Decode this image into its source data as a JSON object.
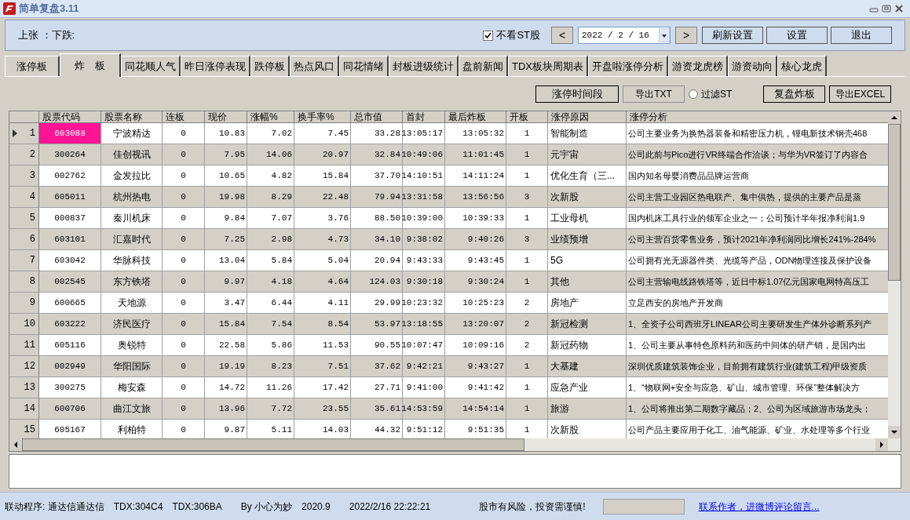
{
  "window": {
    "title": "简单复盘3.11"
  },
  "top_panel": {
    "rise_fall": "上张 ：下跌:",
    "hide_st": {
      "label": "不看ST股",
      "checked": true
    },
    "prev": "<",
    "date": "2022 / 2 / 16",
    "next": ">",
    "buttons": [
      "刷新设置",
      "设置",
      "退出"
    ]
  },
  "tabs": [
    {
      "label": "涨停板",
      "selected": false
    },
    {
      "label": "炸　板",
      "selected": true
    },
    {
      "label": "同花顺人气",
      "selected": false
    },
    {
      "label": "昨日涨停表现",
      "selected": false
    },
    {
      "label": "跌停板",
      "selected": false
    },
    {
      "label": "热点风口",
      "selected": false
    },
    {
      "label": "同花情绪",
      "selected": false
    },
    {
      "label": "封板进级统计",
      "selected": false
    },
    {
      "label": "盘前新闻",
      "selected": false
    },
    {
      "label": "TDX板块周期表",
      "selected": false
    },
    {
      "label": "开盘啦涨停分析",
      "selected": false
    },
    {
      "label": "游资龙虎榜",
      "selected": false
    },
    {
      "label": "游资动向",
      "selected": false
    },
    {
      "label": "核心龙虎",
      "selected": false
    }
  ],
  "toolbar": {
    "time_button": "涨停时间段",
    "export_txt": "导出TXT",
    "filter_st": {
      "label": "过滤ST",
      "checked": false
    },
    "replay_button": "复盘炸板",
    "export_excel": "导出EXCEL"
  },
  "table": {
    "columns": [
      "股票代码",
      "股票名称",
      "连板",
      "现价",
      "涨幅%",
      "换手率%",
      "总市值",
      "首封",
      "最后炸板",
      "开板",
      "涨停原因",
      "涨停分析"
    ],
    "rows": [
      {
        "index": "1",
        "selected": true,
        "cells": [
          "603088",
          "宁波精达",
          "0",
          "10.83",
          "7.02",
          "7.45",
          "33.28",
          "13:05:17",
          "13:05:32",
          "1",
          "智能制造",
          "公司主要业务为换热器装备和精密压力机，锂电新技术钢壳468"
        ]
      },
      {
        "index": "2",
        "selected": false,
        "cells": [
          "300264",
          "佳创视讯",
          "0",
          "7.95",
          "14.06",
          "20.97",
          "32.84",
          "10:49:06",
          "11:01:45",
          "1",
          "元宇宙",
          "公司此前与Pico进行VR终端合作洽谈；与华为VR签订了内容合"
        ]
      },
      {
        "index": "3",
        "selected": false,
        "cells": [
          "002762",
          "金发拉比",
          "0",
          "10.65",
          "4.82",
          "15.84",
          "37.70",
          "14:10:51",
          "14:11:24",
          "1",
          "优化生育（三...",
          "国内知名母婴消费品品牌运营商"
        ]
      },
      {
        "index": "4",
        "selected": false,
        "cells": [
          "605011",
          "杭州热电",
          "0",
          "19.98",
          "8.29",
          "22.48",
          "79.94",
          "13:31:58",
          "13:56:56",
          "3",
          "次新股",
          "公司主营工业园区热电联产、集中供热，提供的主要产品是蒸"
        ]
      },
      {
        "index": "5",
        "selected": false,
        "cells": [
          "000837",
          "秦川机床",
          "0",
          "9.84",
          "7.07",
          "3.76",
          "88.50",
          "10:39:00",
          "10:39:33",
          "1",
          "工业母机",
          "国内机床工具行业的领军企业之一；公司预计半年报净利润1.9"
        ]
      },
      {
        "index": "6",
        "selected": false,
        "cells": [
          "603101",
          "汇嘉时代",
          "0",
          "7.25",
          "2.98",
          "4.73",
          "34.10",
          "9:38:02",
          "9:40:26",
          "3",
          "业绩预增",
          "公司主营百货零售业务，预计2021年净利润同比增长241%-284%"
        ]
      },
      {
        "index": "7",
        "selected": false,
        "cells": [
          "603042",
          "华脉科技",
          "0",
          "13.04",
          "5.84",
          "5.04",
          "20.94",
          "9:43:33",
          "9:43:45",
          "1",
          "5G",
          "公司拥有光无源器件类、光缆等产品，ODN物理连接及保护设备"
        ]
      },
      {
        "index": "8",
        "selected": false,
        "cells": [
          "002545",
          "东方铁塔",
          "0",
          "9.97",
          "4.18",
          "4.64",
          "124.03",
          "9:30:18",
          "9:30:24",
          "1",
          "其他",
          "公司主营输电线路铁塔等，近日中标1.07亿元国家电网特高压工"
        ]
      },
      {
        "index": "9",
        "selected": false,
        "cells": [
          "600665",
          "天地源",
          "0",
          "3.47",
          "6.44",
          "4.11",
          "29.99",
          "10:23:32",
          "10:25:23",
          "2",
          "房地产",
          "立足西安的房地产开发商"
        ]
      },
      {
        "index": "10",
        "selected": false,
        "cells": [
          "603222",
          "济民医疗",
          "0",
          "15.84",
          "7.54",
          "8.54",
          "53.97",
          "13:18:55",
          "13:20:07",
          "2",
          "新冠检测",
          "1、全资子公司西班牙LINEAR公司主要研发生产体外诊断系列产"
        ]
      },
      {
        "index": "11",
        "selected": false,
        "cells": [
          "605116",
          "奥锐特",
          "0",
          "22.58",
          "5.86",
          "11.53",
          "90.55",
          "10:07:47",
          "10:09:16",
          "2",
          "新冠药物",
          "1、公司主要从事特色原料药和医药中间体的研产销，是国内出"
        ]
      },
      {
        "index": "12",
        "selected": false,
        "cells": [
          "002949",
          "华阳国际",
          "0",
          "19.19",
          "8.23",
          "7.51",
          "37.62",
          "9:42:21",
          "9:43:27",
          "1",
          "大基建",
          "深圳优质建筑装饰企业，目前拥有建筑行业(建筑工程)甲级资质"
        ]
      },
      {
        "index": "13",
        "selected": false,
        "cells": [
          "300275",
          "梅安森",
          "0",
          "14.72",
          "11.26",
          "17.42",
          "27.71",
          "9:41:00",
          "9:41:42",
          "1",
          "应急产业",
          "1、“物联网+安全与应急、矿山、城市管理、环保”整体解决方"
        ]
      },
      {
        "index": "14",
        "selected": false,
        "cells": [
          "600706",
          "曲江文旅",
          "0",
          "13.96",
          "7.72",
          "23.55",
          "35.61",
          "14:53:59",
          "14:54:14",
          "1",
          "旅游",
          "1、公司将推出第二期数字藏品；2、公司为区域旅游市场龙头；"
        ]
      },
      {
        "index": "15",
        "selected": false,
        "cells": [
          "605167",
          "利柏特",
          "0",
          "9.87",
          "5.11",
          "14.03",
          "44.32",
          "9:51:12",
          "9:51:35",
          "1",
          "次新股",
          "公司产品主要应用于化工、油气能源、矿业、水处理等多个行业"
        ]
      }
    ]
  },
  "status_bar": {
    "items": [
      "联动程序: 通达信通达信",
      "TDX:304C4",
      "TDX:306BA",
      "By 小心为妙",
      "2020.9",
      "2022/2/16 22:22:21",
      "股市有风险，投资需谨慎!"
    ],
    "link": "联系作者，进微博评论留言..."
  }
}
